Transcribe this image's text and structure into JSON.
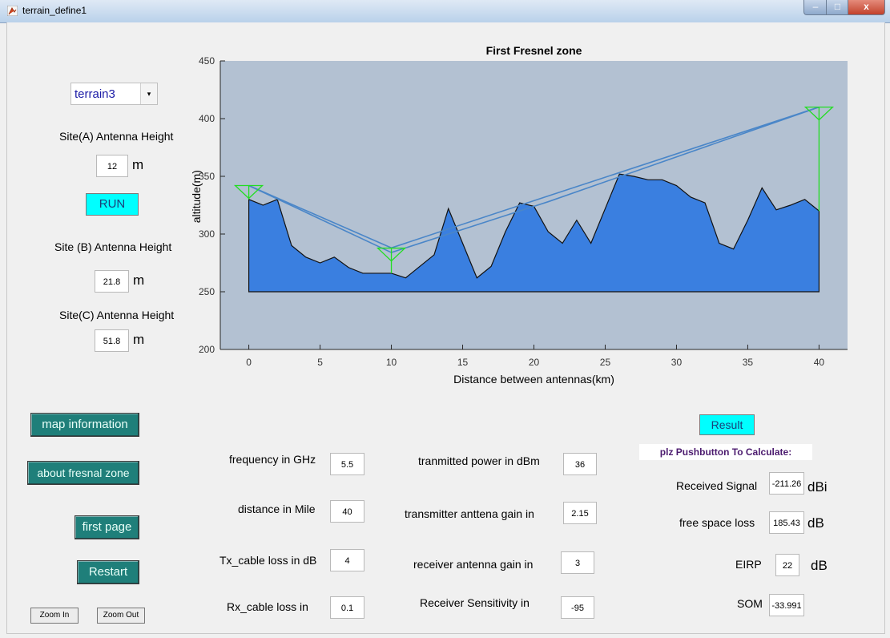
{
  "window": {
    "title": "terrain_define1",
    "min_icon": "minimize-icon",
    "max_icon": "maximize-icon",
    "close_label": "x"
  },
  "terrain_select": {
    "value": "terrain3",
    "arrow": "▾"
  },
  "siteA": {
    "label": "Site(A) Antenna Height",
    "value": "12",
    "unit": "m"
  },
  "run_button": "RUN",
  "siteB": {
    "label": "Site (B) Antenna Height",
    "value": "21.8",
    "unit": "m"
  },
  "siteC": {
    "label": "Site(C) Antenna Height",
    "value": "51.8",
    "unit": "m"
  },
  "buttons": {
    "map_info": "map information",
    "about_fresnel": "about fresnal zone",
    "first_page": "first page",
    "restart": "Restart",
    "zoom_in": "Zoom In",
    "zoom_out": "Zoom Out",
    "result": "Result"
  },
  "params_left": [
    {
      "label": "frequency in GHz",
      "value": "5.5"
    },
    {
      "label": "distance in Mile",
      "value": "40"
    },
    {
      "label": "Tx_cable loss in dB",
      "value": "4"
    },
    {
      "label": "Rx_cable loss in",
      "value": "0.1"
    }
  ],
  "params_mid": [
    {
      "label": "tranmitted power in dBm",
      "value": "36"
    },
    {
      "label": "transmitter anttena gain in",
      "value": "2.15"
    },
    {
      "label": "receiver antenna gain in",
      "value": "3"
    },
    {
      "label": "Receiver Sensitivity in",
      "value": "-95"
    }
  ],
  "results": {
    "prompt": "plz Pushbutton To Calculate:",
    "rows": [
      {
        "label": "Received Signal",
        "value": "-211.26",
        "unit": "dBi"
      },
      {
        "label": "free space loss",
        "value": "185.43",
        "unit": "dB"
      },
      {
        "label": "EIRP",
        "value": "22",
        "unit": "dB"
      },
      {
        "label": "SOM",
        "value": "-33.991",
        "unit": ""
      }
    ]
  },
  "colors": {
    "plot_bg": "#b3c1d2",
    "terrain_fill": "#3a7fe0",
    "fresnel_line": "#4a86c8",
    "antenna": "#22dd22",
    "teal_button": "#1f7f7a",
    "cyan_button": "#00ffff"
  },
  "chart_data": {
    "type": "area",
    "title": "First Fresnel zone",
    "xlabel": "Distance between antennas(km)",
    "ylabel": "altitude(m)",
    "xlim": [
      -2,
      42
    ],
    "ylim": [
      200,
      450
    ],
    "xticks": [
      0,
      5,
      10,
      15,
      20,
      25,
      30,
      35,
      40
    ],
    "yticks": [
      200,
      250,
      300,
      350,
      400,
      450
    ],
    "grid": false,
    "terrain_base": 250,
    "terrain": {
      "x": [
        0,
        1,
        2,
        3,
        4,
        5,
        6,
        7,
        8,
        9,
        10,
        11,
        12,
        13,
        14,
        15,
        16,
        17,
        18,
        19,
        20,
        21,
        22,
        23,
        24,
        25,
        26,
        27,
        28,
        29,
        30,
        31,
        32,
        33,
        34,
        35,
        36,
        37,
        38,
        39,
        40
      ],
      "y": [
        330,
        325,
        330,
        290,
        280,
        275,
        280,
        271,
        266,
        266,
        266,
        262,
        272,
        282,
        322,
        292,
        262,
        272,
        302,
        327,
        324,
        302,
        292,
        312,
        292,
        322,
        352,
        350,
        347,
        347,
        342,
        332,
        327,
        292,
        287,
        312,
        340,
        321,
        325,
        330,
        320
      ]
    },
    "fresnel": [
      {
        "name": "",
        "x": [
          0,
          10,
          21,
          40
        ],
        "y": [
          342,
          288,
          333,
          410
        ]
      },
      {
        "name": "",
        "x": [
          0,
          10,
          21,
          40
        ],
        "y": [
          342,
          284,
          328,
          410
        ]
      }
    ],
    "antennas": [
      {
        "x": 0,
        "ground": 330,
        "top": 342
      },
      {
        "x": 10,
        "ground": 266,
        "top": 287.8
      },
      {
        "x": 40,
        "ground": 320,
        "top": 410
      }
    ]
  }
}
